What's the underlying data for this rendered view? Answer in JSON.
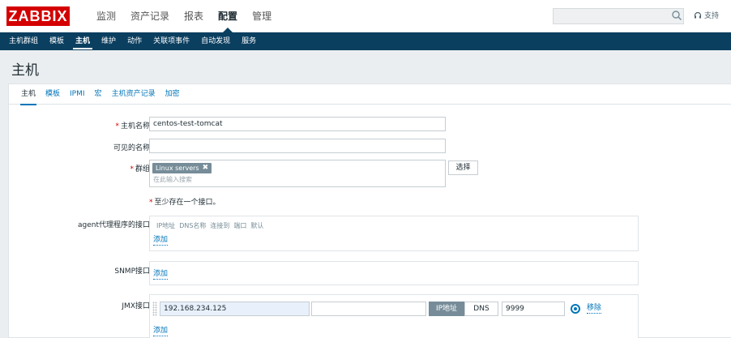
{
  "header": {
    "logo": "ZABBIX",
    "menu": [
      {
        "label": "监测",
        "active": false
      },
      {
        "label": "资产记录",
        "active": false
      },
      {
        "label": "报表",
        "active": false
      },
      {
        "label": "配置",
        "active": true
      },
      {
        "label": "管理",
        "active": false
      }
    ],
    "search": {
      "value": "",
      "icon": "search-icon"
    },
    "support": {
      "label": "支持",
      "icon": "headset-icon"
    }
  },
  "submenu": [
    {
      "label": "主机群组",
      "active": false
    },
    {
      "label": "模板",
      "active": false
    },
    {
      "label": "主机",
      "active": true
    },
    {
      "label": "维护",
      "active": false
    },
    {
      "label": "动作",
      "active": false
    },
    {
      "label": "关联项事件",
      "active": false
    },
    {
      "label": "自动发现",
      "active": false
    },
    {
      "label": "服务",
      "active": false
    }
  ],
  "page": {
    "title": "主机"
  },
  "tabs": [
    {
      "label": "主机",
      "active": true
    },
    {
      "label": "模板",
      "active": false
    },
    {
      "label": "IPMI",
      "active": false
    },
    {
      "label": "宏",
      "active": false
    },
    {
      "label": "主机资产记录",
      "active": false
    },
    {
      "label": "加密",
      "active": false
    }
  ],
  "form": {
    "required_mark": "*",
    "hostname": {
      "label": "主机名称",
      "value": "centos-test-tomcat"
    },
    "visible_name": {
      "label": "可见的名称",
      "value": ""
    },
    "groups": {
      "label": "群组",
      "chips": [
        "Linux servers"
      ],
      "chip_remove": "✖",
      "placeholder": "在此输入搜索",
      "select_button": "选择"
    },
    "interface_hint": "至少存在一个接口。",
    "agent": {
      "label": "agent代理程序的接口",
      "columns": [
        "IP地址",
        "DNS名称",
        "连接到",
        "端口",
        "默认"
      ],
      "add": "添加"
    },
    "snmp": {
      "label": "SNMP接口",
      "add": "添加"
    },
    "jmx": {
      "label": "JMX接口",
      "ip": "192.168.234.125",
      "dns": "",
      "connect_ip": "IP地址",
      "connect_dns": "DNS",
      "connect_selected": "IP地址",
      "port": "9999",
      "default": true,
      "remove": "移除",
      "add": "添加"
    }
  },
  "colors": {
    "brand": "#d40000",
    "nav": "#0b3f60",
    "link": "#0275b8",
    "chip": "#768d99"
  }
}
